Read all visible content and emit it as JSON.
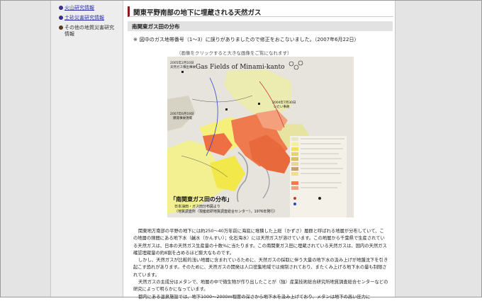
{
  "sidebar": {
    "items": [
      {
        "label": "火山研究情報",
        "link": true
      },
      {
        "label": "土砂災害研究情報",
        "link": true
      },
      {
        "label": "その他の地質災害研究",
        "label2": "情報",
        "link": false
      }
    ]
  },
  "page": {
    "title": "関東平野南部の地下に埋蔵される天然ガス",
    "subtitle": "南関東ガス田の分布",
    "notice_mark": "※",
    "notice": "図中のガス地帯番号（1〜3）に誤りがありましたので修正をおこないました。（2007年6月22日）",
    "click_note": "（画像をクリックすると大きな画像をご覧になれます）"
  },
  "map": {
    "title_en": "Gas Fields of Minami-kanto",
    "caption": "「南関東ガス田の分布」",
    "caption_sub1": "日本油田・ガス田分布図より",
    "caption_sub2": "（地質調査所（現産総研地質調査総合センター），1976年発行）",
    "label_2005": "2005年2月10日",
    "label_2005b": "天然ガス噴出事故",
    "label_2007": "2007年6月19日",
    "label_2007b": "爆発事故現場",
    "label_2004": "2004年7月30日",
    "label_2004b": "いたい事故"
  },
  "body": {
    "paragraphs": [
      "関東地方南部の平野の地下には約250〜40万年前に海底に堆積した上総（かずさ）層群と呼ばれる地層が分布していて、この地層の隙間にある地下水（鹹水（かんすい）；化石海水）には天然ガスが溶けています。この地層から千葉県で生産されている天然ガスは、日本の天然ガス生産量の十数%に当たります。この南関東ガス田に埋蔵されている天然ガスは、国内の天然ガス確認埋蔵量の約8割を占めるほど膨大なものです。",
      "しかし、天然ガスが比較的浅い地層に含まれているために、天然ガスの採取に伴う大量の地下水の汲み上げが地盤沈下を引き起こす恐れがあります。そのために、天然ガスの開発は人口密集地域では規制されており、またくみ上げる地下水の量も制限されています。",
      "天然ガスの主成分はメタンで、地層の中で微生物が作り出したことが（独）産業技術総合研究所地質調査総合センターなどの研究によって明らかになっています。",
      "都内にある温泉施設では、地下1000〜2000m程度の深さから地下水を汲み上げており、メタンは地下の高い圧力に"
    ]
  }
}
